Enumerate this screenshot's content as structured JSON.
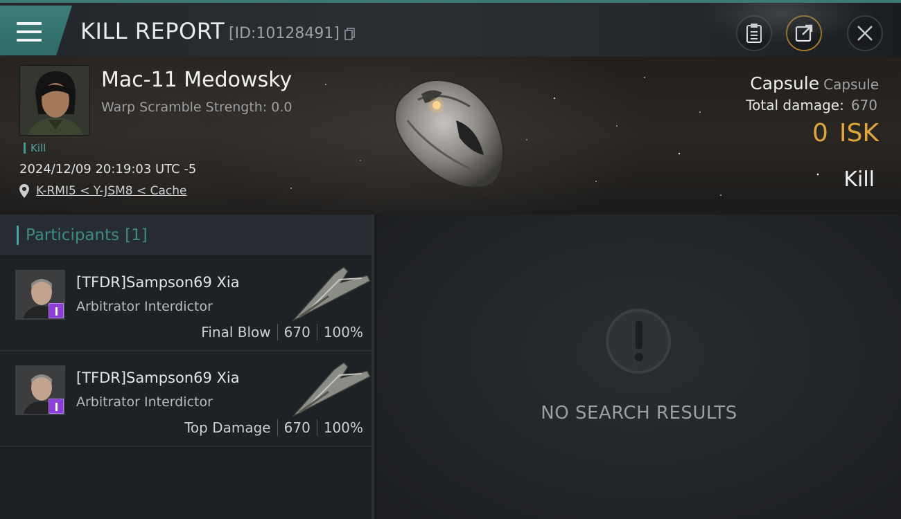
{
  "header": {
    "title": "KILL REPORT",
    "report_id": "[ID:10128491]",
    "buttons": [
      "clipboard-icon",
      "share-icon",
      "close-icon"
    ]
  },
  "victim": {
    "name": "Mac-11 Medowsky",
    "warp_scramble": "Warp Scramble Strength: 0.0",
    "tag": "Kill",
    "date": "2024/12/09 20:19:03 UTC -5",
    "location": "K-RMI5 < Y-JSM8 < Cache",
    "ship_name": "Capsule",
    "ship_class": "Capsule",
    "total_damage_label": "Total damage:",
    "total_damage_value": "670",
    "isk_value": "0",
    "isk_unit": "ISK",
    "result": "Kill"
  },
  "participants": {
    "title": "Participants",
    "count": "[1]",
    "rows": [
      {
        "name": "[TFDR]Sampson69 Xia",
        "ship": "Arbitrator Interdictor",
        "role": "Final Blow",
        "damage": "670",
        "percent": "100%"
      },
      {
        "name": "[TFDR]Sampson69 Xia",
        "ship": "Arbitrator Interdictor",
        "role": "Top Damage",
        "damage": "670",
        "percent": "100%"
      }
    ]
  },
  "results_panel": {
    "empty_text": "NO SEARCH RESULTS"
  },
  "colors": {
    "accent": "#3c7a76",
    "isk": "#e0a63b",
    "badge": "#8b3fd6"
  }
}
